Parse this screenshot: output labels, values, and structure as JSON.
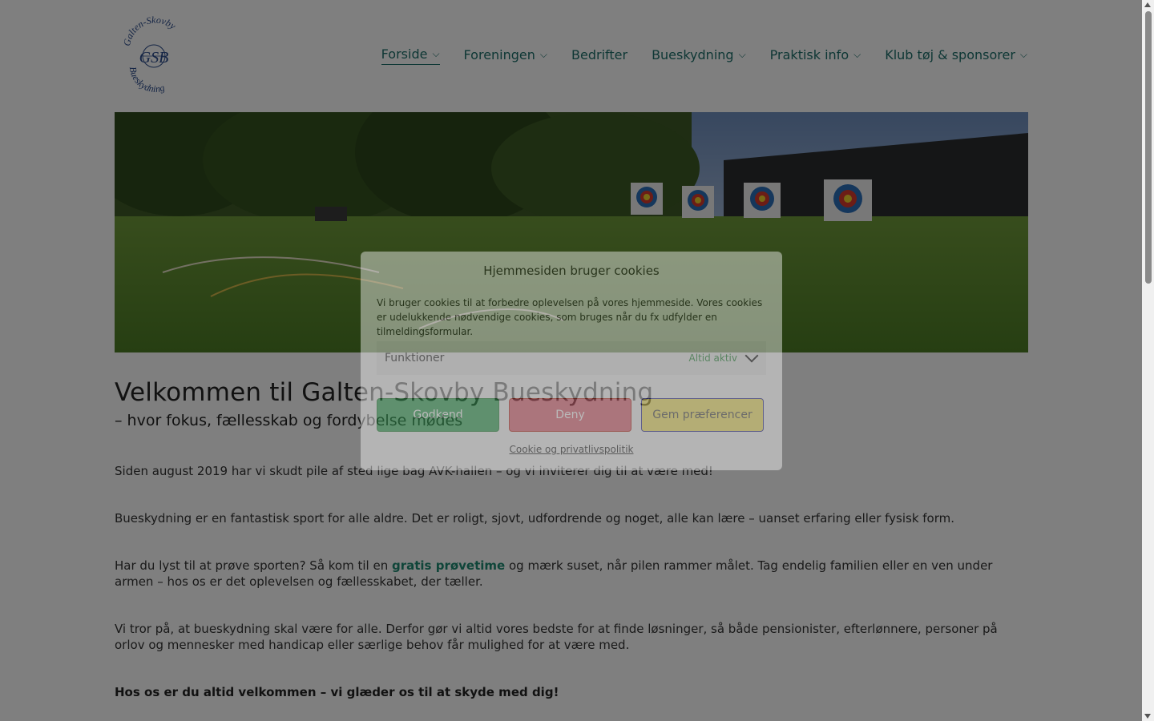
{
  "logo": {
    "line1": "Galten-Skovby",
    "monogram": "GSB",
    "line2": "Bueskydning"
  },
  "nav": {
    "items": [
      {
        "label": "Forside",
        "dropdown": true,
        "active": true
      },
      {
        "label": "Foreningen",
        "dropdown": true
      },
      {
        "label": "Bedrifter",
        "dropdown": false
      },
      {
        "label": "Bueskydning",
        "dropdown": true
      },
      {
        "label": "Praktisk info",
        "dropdown": true
      },
      {
        "label": "Klub tøj & sponsorer",
        "dropdown": true
      }
    ],
    "chevron": "⌵"
  },
  "hero": {
    "icon": "archery-range-photo"
  },
  "main": {
    "title": "Velkommen til Galten-Skovby Bueskydning",
    "subtitle": "– hvor fokus, fællesskab og fordybelse mødes",
    "p1": "Siden august 2019 har vi skudt pile af sted lige bag AVK-hallen – og vi inviterer dig til at være med!",
    "p2": "Bueskydning er en fantastisk sport for alle aldre. Det er roligt, sjovt, udfordrende og noget, alle kan lære – uanset erfaring eller fysisk form.",
    "p3_before": "Har du lyst til at prøve sporten? Så kom til en ",
    "p3_link": "gratis prøvetime",
    "p3_after": " og mærk suset, når pilen rammer målet. Tag endelig familien eller en ven under armen – hos os er det oplevelsen og fællesskabet, der tæller.",
    "p4": "Vi tror på, at bueskydning skal være for alle. Derfor gør vi altid vores bedste for at finde løsninger, så både pensionister, efterlønnere, personer på orlov og mennesker med handicap eller særlige behov får mulighed for at være med.",
    "p5": "Hos os er du altid velkommen – vi glæder os til at skyde med dig!"
  },
  "cookie": {
    "title": "Hjemmesiden bruger cookies",
    "text": "Vi bruger cookies til at forbedre oplevelsen på vores hjemmeside. Vores cookies er udelukkende nødvendige cookies, som bruges når du fx udfylder en tilmeldingsformular.",
    "functions_label": "Funktioner",
    "functions_status": "Altid aktiv",
    "accept": "Godkend",
    "deny": "Deny",
    "preferences": "Gem præferencer",
    "policy_link": "Cookie og privatlivspolitik"
  },
  "colors": {
    "accent": "#1d6f6a",
    "link": "#1e8a72",
    "accept": "#3ba55b",
    "deny": "#e06a7a",
    "prefs": "#f4e36a"
  }
}
